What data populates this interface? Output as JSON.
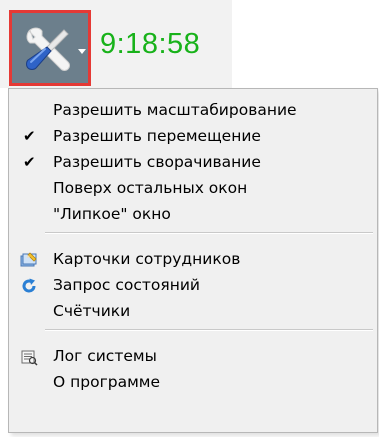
{
  "toolbar": {
    "tools_icon": "tools-icon",
    "dropdown_icon": "caret-down-icon",
    "time": "9:18:58",
    "colors": {
      "time": "#18b21a",
      "button_bg": "#6c7f8c",
      "button_border": "#e53935"
    }
  },
  "menu": {
    "items": [
      {
        "label": "Разрешить масштабирование",
        "checked": false
      },
      {
        "label": "Разрешить перемещение",
        "checked": true
      },
      {
        "label": "Разрешить сворачивание",
        "checked": true
      },
      {
        "label": "Поверх остальных окон",
        "checked": false
      },
      {
        "label": "\"Липкое\" окно",
        "checked": false
      },
      {
        "label": "Карточки сотрудников",
        "icon": "employee-cards-icon"
      },
      {
        "label": "Запрос состояний",
        "icon": "refresh-icon"
      },
      {
        "label": "Счётчики"
      },
      {
        "label": "Лог системы",
        "icon": "log-icon"
      },
      {
        "label": "О программе"
      }
    ],
    "check_glyph": "✔"
  }
}
